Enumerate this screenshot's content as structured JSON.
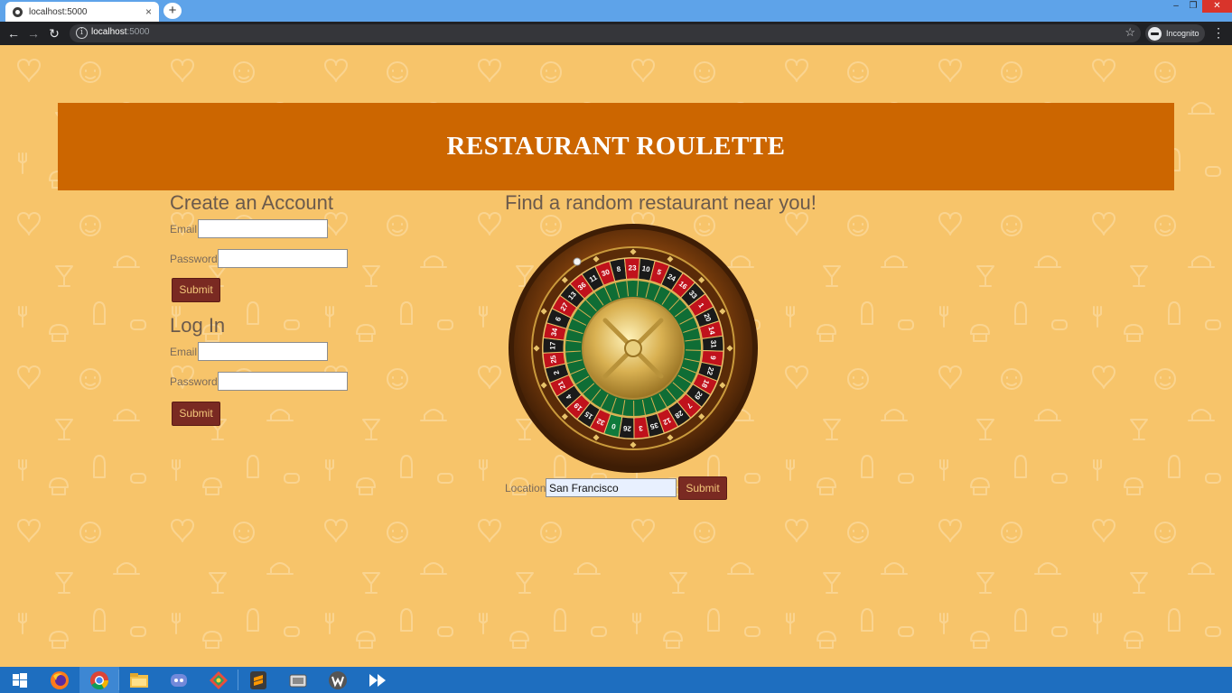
{
  "browser": {
    "tab_title": "localhost:5000",
    "tab_close": "×",
    "new_tab": "+",
    "window_controls": {
      "minimize": "–",
      "maximize": "❐",
      "close": "✕"
    },
    "nav": {
      "back": "←",
      "forward": "→",
      "reload": "↻"
    },
    "url_host": "localhost",
    "url_port": ":5000",
    "info_icon": "i",
    "star": "☆",
    "incognito_label": "Incognito",
    "menu": "⋮"
  },
  "page": {
    "title": "RESTAURANT ROULETTE",
    "create_account": {
      "heading": "Create an Account",
      "email_label": "Email",
      "email_value": "",
      "password_label": "Password",
      "password_value": "",
      "submit_label": "Submit"
    },
    "login": {
      "heading": "Log In",
      "email_label": "Email",
      "email_value": "",
      "password_label": "Password",
      "password_value": "",
      "submit_label": "Submit"
    },
    "finder": {
      "heading": "Find a random restaurant near you!",
      "location_label": "Location",
      "location_value": "San Francisco",
      "submit_label": "Submit"
    },
    "wheel_numbers": [
      "0",
      "32",
      "15",
      "19",
      "4",
      "21",
      "2",
      "25",
      "17",
      "34",
      "6",
      "27",
      "13",
      "36",
      "11",
      "30",
      "8",
      "23",
      "10",
      "5",
      "24",
      "16",
      "33",
      "1",
      "20",
      "14",
      "31",
      "9",
      "22",
      "18",
      "29",
      "7",
      "28",
      "12",
      "35",
      "3",
      "26"
    ]
  },
  "colors": {
    "background": "#f7c46a",
    "banner": "#cc6600",
    "button": "#7a2a22",
    "button_text": "#f3c77a",
    "wheel_red": "#c0121c",
    "wheel_black": "#1a1a1a",
    "wheel_green": "#0f7a3c",
    "taskbar": "#1e6ebf"
  },
  "taskbar": {
    "items": [
      "start-icon",
      "firefox-icon",
      "chrome-icon",
      "file-explorer-icon",
      "discord-icon",
      "sourcetree-icon",
      "sublime-text-icon",
      "screen-recorder-icon",
      "w-app-icon",
      "media-forward-icon"
    ]
  }
}
